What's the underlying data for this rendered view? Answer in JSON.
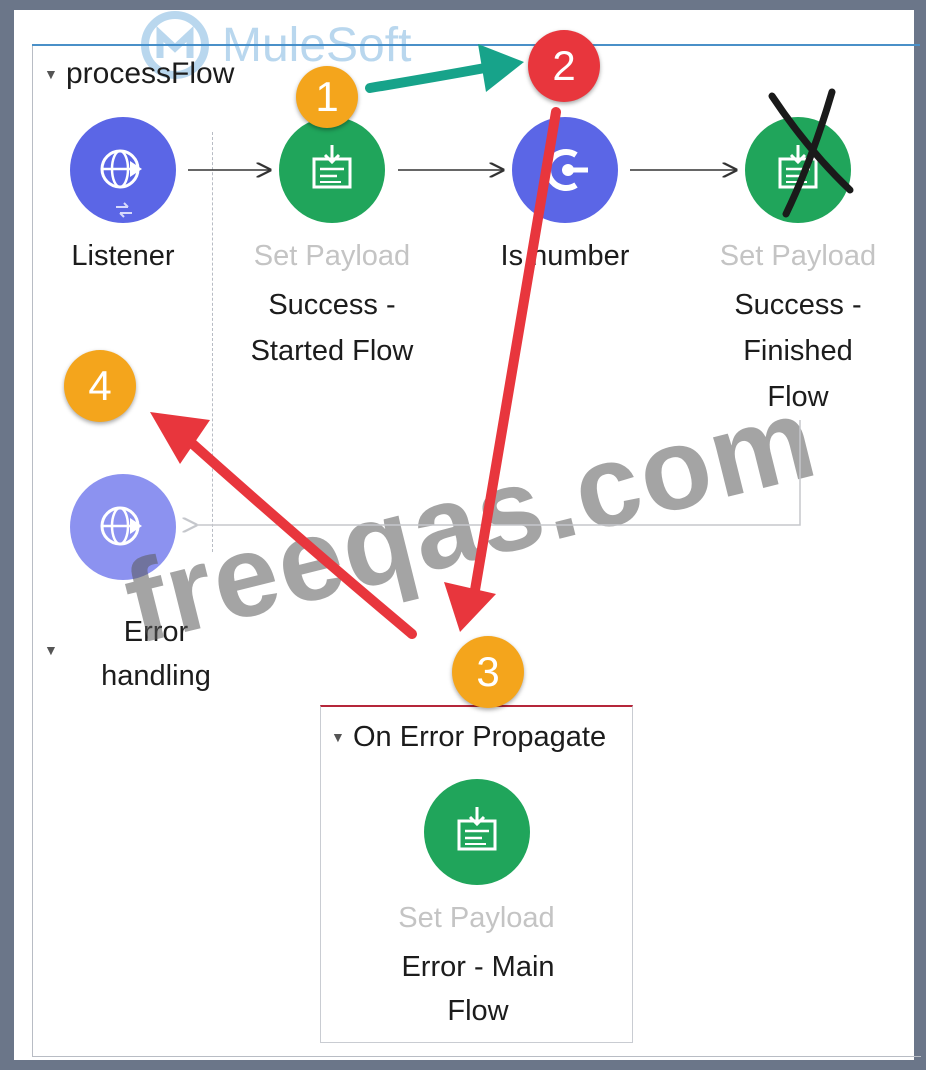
{
  "flow": {
    "name": "processFlow",
    "logo_text": "MuleSoft",
    "nodes": [
      {
        "id": "listener",
        "type_label": "",
        "label": "Listener",
        "icon": "globe-listener-icon",
        "color": "#5b66e6"
      },
      {
        "id": "set-payload-1",
        "type_label": "Set Payload",
        "label": "Success - Started Flow",
        "icon": "set-payload-icon",
        "color": "#20a55b"
      },
      {
        "id": "isnumber",
        "type_label": "",
        "label": "Is number",
        "icon": "flow-ref-icon",
        "color": "#5b66e6"
      },
      {
        "id": "set-payload-2",
        "type_label": "Set Payload",
        "label": "Success - Finished Flow",
        "icon": "set-payload-icon",
        "color": "#20a55b",
        "crossed_out": true
      }
    ],
    "error_source": {
      "icon": "globe-listener-icon",
      "color": "#8c92f0"
    }
  },
  "error_handling": {
    "label": "Error handling",
    "block_title": "On Error Propagate",
    "node": {
      "type_label": "Set Payload",
      "label": "Error - Main Flow",
      "icon": "set-payload-icon",
      "color": "#20a55b"
    }
  },
  "annotations": {
    "badges": [
      {
        "number": "1",
        "color": "#f4a51c"
      },
      {
        "number": "2",
        "color": "#e8363d"
      },
      {
        "number": "3",
        "color": "#f4a51c"
      },
      {
        "number": "4",
        "color": "#f4a51c"
      }
    ],
    "arrow_colors": {
      "teal": "#17a38a",
      "red": "#e8363d"
    }
  },
  "watermark": "freeqas.com"
}
